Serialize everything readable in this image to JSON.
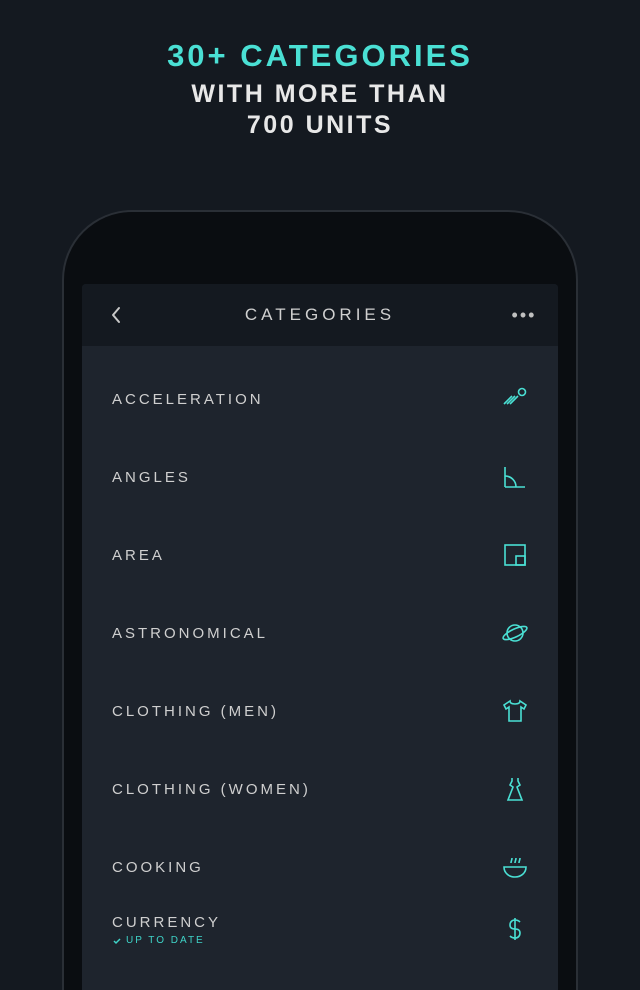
{
  "promo": {
    "line1": "30+ CATEGORIES",
    "line2": "WITH MORE THAN",
    "line3": "700 UNITS"
  },
  "navbar": {
    "title": "CATEGORIES"
  },
  "categories": [
    {
      "label": "ACCELERATION",
      "icon": "acceleration"
    },
    {
      "label": "ANGLES",
      "icon": "angle"
    },
    {
      "label": "AREA",
      "icon": "area"
    },
    {
      "label": "ASTRONOMICAL",
      "icon": "planet"
    },
    {
      "label": "CLOTHING (MEN)",
      "icon": "tshirt"
    },
    {
      "label": "CLOTHING (WOMEN)",
      "icon": "dress"
    },
    {
      "label": "COOKING",
      "icon": "bowl"
    },
    {
      "label": "CURRENCY",
      "icon": "dollar",
      "subtext": "UP TO DATE"
    }
  ]
}
